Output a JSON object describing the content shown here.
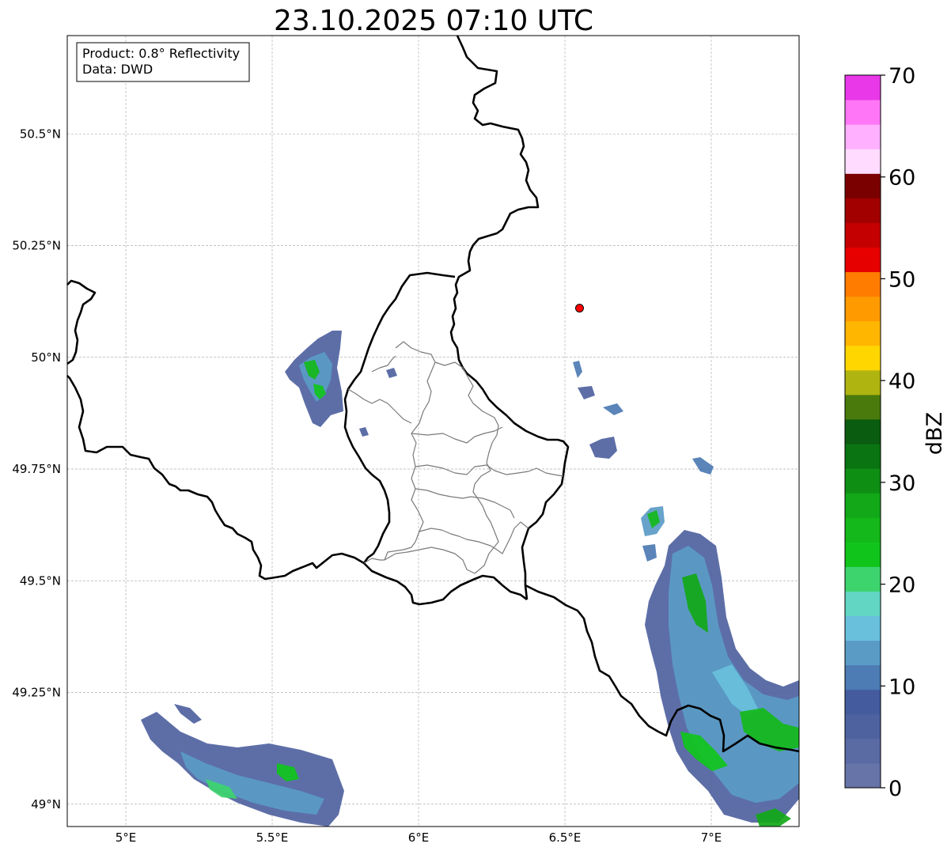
{
  "title": "23.10.2025 07:10 UTC",
  "info_box": {
    "product": "Product: 0.8° Reflectivity",
    "source": "Data: DWD"
  },
  "map": {
    "extent_lon": [
      4.8,
      7.3
    ],
    "extent_lat": [
      48.95,
      50.72
    ],
    "gridlines": true,
    "lon_ticks": [
      {
        "lon": 5.0,
        "label": "5°E"
      },
      {
        "lon": 5.5,
        "label": "5.5°E"
      },
      {
        "lon": 6.0,
        "label": "6°E"
      },
      {
        "lon": 6.5,
        "label": "6.5°E"
      },
      {
        "lon": 7.0,
        "label": "7°E"
      }
    ],
    "lat_ticks": [
      {
        "lat": 49.0,
        "label": "49°N"
      },
      {
        "lat": 49.25,
        "label": "49.25°N"
      },
      {
        "lat": 49.5,
        "label": "49.5°N"
      },
      {
        "lat": 49.75,
        "label": "49.75°N"
      },
      {
        "lat": 50.0,
        "label": "50°N"
      },
      {
        "lat": 50.25,
        "label": "50.25°N"
      },
      {
        "lat": 50.5,
        "label": "50.5°N"
      }
    ],
    "radar_site": {
      "lon": 6.55,
      "lat": 50.11,
      "color": "#ff0000"
    }
  },
  "colorbar": {
    "label": "dBZ",
    "min": 0,
    "max": 70,
    "ticks": [
      {
        "value": 0,
        "label": "0"
      },
      {
        "value": 10,
        "label": "10"
      },
      {
        "value": 20,
        "label": "20"
      },
      {
        "value": 30,
        "label": "30"
      },
      {
        "value": 40,
        "label": "40"
      },
      {
        "value": 50,
        "label": "50"
      },
      {
        "value": 60,
        "label": "60"
      },
      {
        "value": 70,
        "label": "70"
      }
    ],
    "colors": [
      "#6674a8",
      "#5a6aa3",
      "#4f62a0",
      "#445c9e",
      "#4d7bb3",
      "#5a9bc6",
      "#68c0dc",
      "#62d6c2",
      "#3dd46e",
      "#10c41c",
      "#14b81a",
      "#12a818",
      "#0f8e14",
      "#0a7412",
      "#0a5c10",
      "#4a7a0c",
      "#b0b410",
      "#ffd600",
      "#ffb600",
      "#ff9a00",
      "#ff7c00",
      "#e60000",
      "#c40000",
      "#a20000",
      "#7a0000",
      "#ffdcff",
      "#ffb0ff",
      "#ff76f6",
      "#e838e8"
    ]
  }
}
